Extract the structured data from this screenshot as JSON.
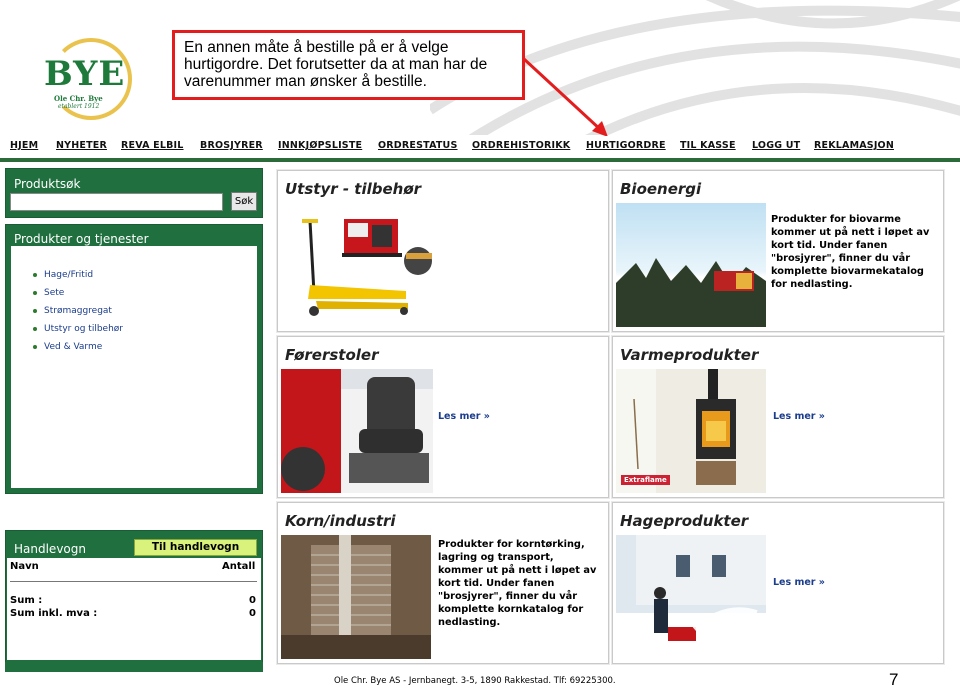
{
  "callout": {
    "line1": "En annen måte å bestille på er å velge",
    "line2": "hurtigordre. Det forutsetter da at man har de",
    "line3": "varenummer man ønsker å bestille."
  },
  "logo": {
    "brand": "BYE",
    "sub1": "Ole Chr. Bye",
    "sub2": "etablert 1912"
  },
  "nav": [
    "HJEM",
    "NYHETER",
    "REVA ELBIL",
    "BROSJYRER",
    "INNKJØPSLISTE",
    "ORDRESTATUS",
    "ORDREHISTORIKK",
    "HURTIGORDRE",
    "TIL KASSE",
    "LOGG UT",
    "REKLAMASJON"
  ],
  "search": {
    "title": "Produktsøk",
    "button": "Søk",
    "value": ""
  },
  "categories": {
    "title": "Produkter og tjenester",
    "items": [
      "Hage/Fritid",
      "Sete",
      "Strømaggregat",
      "Utstyr og tilbehør",
      "Ved & Varme"
    ]
  },
  "cart": {
    "title": "Handlevogn",
    "button": "Til handlevogn",
    "col_name": "Navn",
    "col_qty": "Antall",
    "sum_label": "Sum :",
    "sum_value": "0",
    "sum_vat_label": "Sum inkl. mva :",
    "sum_vat_value": "0"
  },
  "tiles": {
    "utstyr": {
      "title": "Utstyr - tilbehør"
    },
    "bioenergi": {
      "title": "Bioenergi",
      "desc": [
        "Produkter for biovarme",
        "kommer ut på nett i løpet av",
        "kort tid. Under fanen",
        "\"brosjyrer\", finner du vår",
        "komplette biovarmekatalog",
        "for nedlasting."
      ]
    },
    "forerstoler": {
      "title": "Førerstoler",
      "link": "Les mer »"
    },
    "varme": {
      "title": "Varmeprodukter",
      "link": "Les mer »",
      "badge": "Extraflame"
    },
    "korn": {
      "title": "Korn/industri",
      "desc": [
        "Produkter for korntørking,",
        "lagring og transport,",
        "kommer ut på nett i løpet av",
        "kort tid. Under fanen",
        "\"brosjyrer\", finner du vår",
        "komplette kornkatalog for",
        "nedlasting."
      ]
    },
    "hage": {
      "title": "Hageprodukter",
      "link": "Les mer »"
    }
  },
  "footer": "Ole Chr. Bye AS - Jernbanegt. 3-5, 1890 Rakkestad. Tlf: 69225300.",
  "page_number": "7",
  "colors": {
    "brand_green": "#1f6f3f",
    "callout_red": "#e31d1d",
    "link_blue": "#1b3d8c"
  }
}
